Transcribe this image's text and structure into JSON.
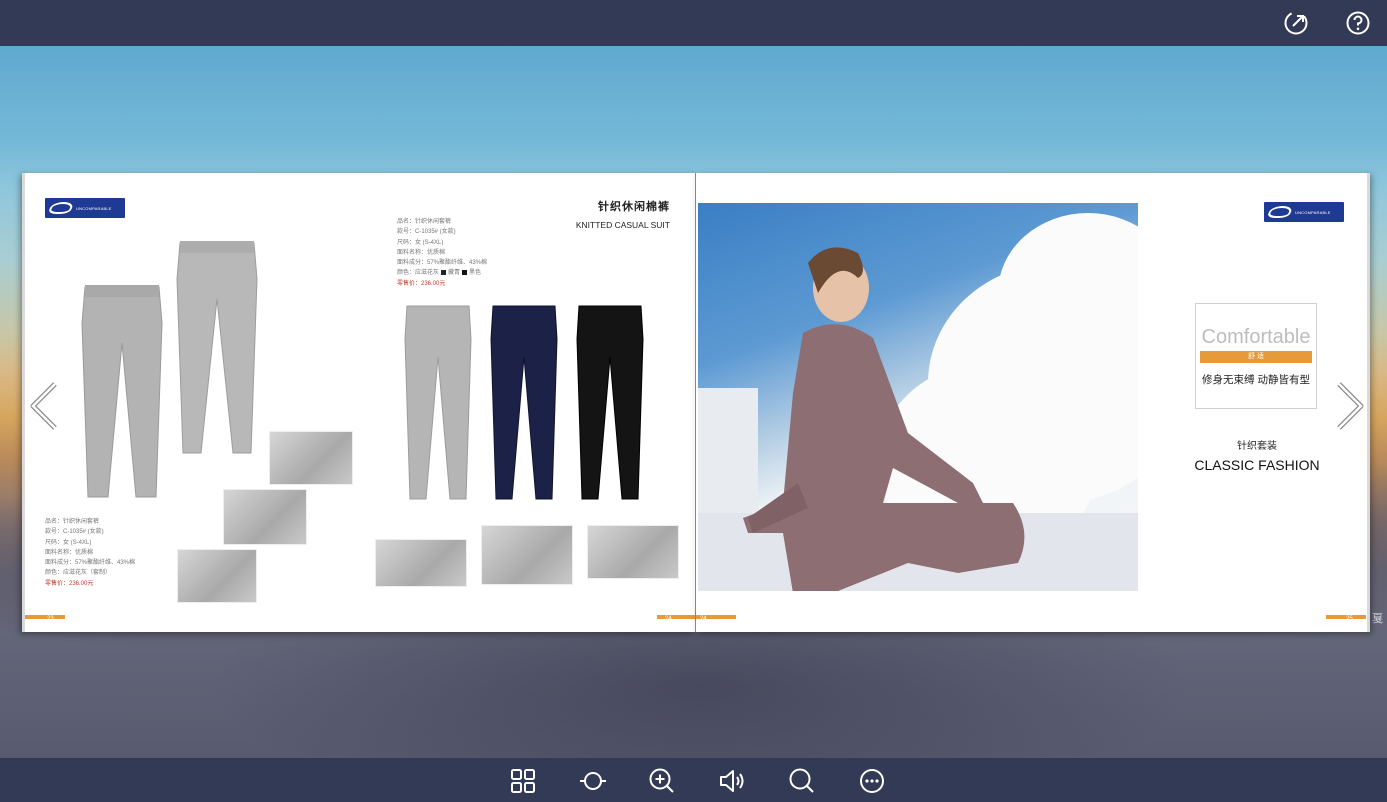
{
  "top_bar": {
    "share_icon": "share-external-icon",
    "help_icon": "help-question-icon"
  },
  "left_page": {
    "title_cn": "针织休闲棉裤",
    "title_en": "KNITTED CASUAL SUIT",
    "logo_text": "UNCOMPARABLE",
    "spec_right": {
      "name": "品名：针织休闲套裤",
      "code": "款号：C-1035# (女款)",
      "size": "尺码：女 (S-4XL)",
      "fabric": "面料名称：优质棉",
      "composition": "面料成分：57%聚酯纤维、43%棉",
      "colors_label": "颜色：应滋花灰",
      "color_a": "藏青",
      "color_b": "黑色",
      "price": "零售价：236.00元"
    },
    "spec_left": {
      "name": "品名：针织休闲套裤",
      "code": "款号：C-1035# (女款)",
      "size": "尺码：女 (S-4XL)",
      "fabric": "面料名称：优质棉",
      "composition": "面料成分：57%聚酯纤维、43%棉",
      "colors": "颜色：应滋花灰（套制）",
      "price": "零售价：236.00元"
    },
    "folio_left": "23",
    "folio_right": "24"
  },
  "right_page": {
    "logo_text": "UNCOMPARABLE",
    "comfort_word": "Comfortable",
    "comfort_tag": "舒 适",
    "comfort_slogan": "修身无束缚  动静皆有型",
    "category_cn": "针织套装",
    "category_en": "CLASSIC FASHION",
    "folio_left": "24",
    "folio_right": "25"
  },
  "side_label": "戛",
  "colors": {
    "bar": "#323a55",
    "accent": "#e79a3a",
    "logo": "#1f3a93"
  },
  "toolbar": [
    {
      "name": "thumbnails-icon"
    },
    {
      "name": "autoflip-icon"
    },
    {
      "name": "zoom-in-icon"
    },
    {
      "name": "sound-icon"
    },
    {
      "name": "search-icon"
    },
    {
      "name": "more-icon"
    }
  ]
}
